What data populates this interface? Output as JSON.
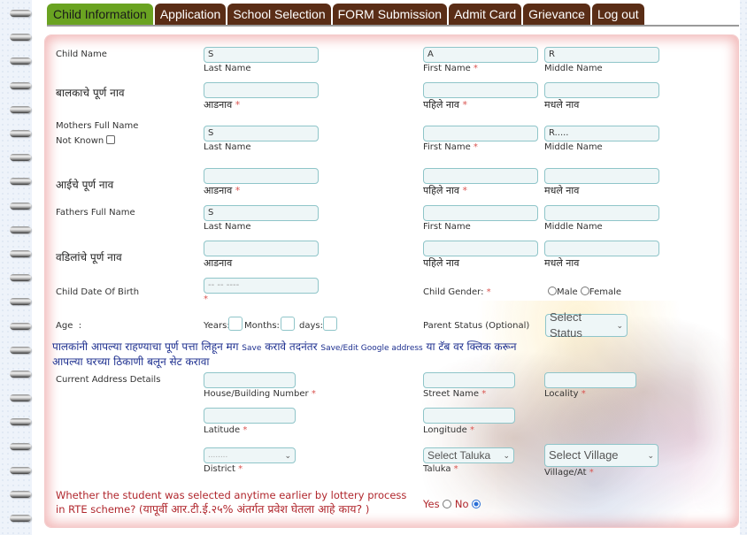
{
  "tabs": [
    {
      "label": "Child Information",
      "active": true
    },
    {
      "label": "Application",
      "active": false
    },
    {
      "label": "School Selection",
      "active": false
    },
    {
      "label": "FORM Submission",
      "active": false
    },
    {
      "label": "Admit Card",
      "active": false
    },
    {
      "label": "Grievance",
      "active": false
    },
    {
      "label": "Log out",
      "active": false
    }
  ],
  "form": {
    "child_name": {
      "label": "Child Name",
      "last_name_value": "S",
      "first_name_value": "A",
      "middle_name_value": "R",
      "last_name_label": "Last Name",
      "first_name_label": "First Name",
      "middle_name_label": "Middle Name"
    },
    "child_name_mr": {
      "label": "बालकाचे पूर्ण नाव",
      "last_name_label": "आडनाव",
      "first_name_label": "पहिले नाव",
      "middle_name_label": "मधले नाव"
    },
    "mother_name": {
      "label": "Mothers Full Name",
      "not_known_label": "Not Known",
      "last_name_value": "S",
      "first_name_value": "",
      "middle_name_value": "R.....",
      "last_name_label": "Last Name",
      "first_name_label": "First Name",
      "middle_name_label": "Middle Name"
    },
    "mother_name_mr": {
      "label": "आईचे पूर्ण नाव",
      "last_name_label": "आडनाव",
      "first_name_label": "पहिले नाव",
      "middle_name_label": "मधले नाव"
    },
    "father_name": {
      "label": "Fathers Full Name",
      "last_name_value": "S",
      "last_name_label": "Last Name",
      "first_name_label": "First Name",
      "middle_name_label": "Middle Name"
    },
    "father_name_mr": {
      "label": "वडिलांचे पूर्ण नाव",
      "last_name_label": "आडनाव",
      "first_name_label": "पहिले नाव",
      "middle_name_label": "मधले नाव"
    },
    "dob": {
      "label": "Child Date Of Birth",
      "value": "-- -- ----"
    },
    "gender": {
      "label": "Child Gender:",
      "options": [
        "Male",
        "Female"
      ],
      "selected": null
    },
    "age": {
      "label": "Age",
      "separator": ":",
      "years_label": "Years:",
      "months_label": "Months:",
      "days_label": "days:"
    },
    "parent_status": {
      "label": "Parent Status (Optional)",
      "selected": "Select Status"
    },
    "notice": {
      "part1": "पालकांनी आपल्या राहण्याचा पूर्ण पत्ता लिहून मग ",
      "save": "Save",
      "part2": " करावे तदनंतर ",
      "save_edit": "Save/Edit Google address",
      "part3": " या टॅब वर क्लिक करून आपल्या घरच्या ठिकाणी बलून सेट करावा"
    },
    "address": {
      "label": "Current Address Details",
      "house_label": "House/Building Number",
      "street_label": "Street Name",
      "locality_label": "Locality",
      "latitude_label": "Latitude",
      "longitude_label": "Longitude",
      "district_label": "District",
      "district_selected": "........",
      "taluka_label": "Taluka",
      "taluka_selected": "Select Taluka",
      "village_label": "Village/At",
      "village_selected": "Select Village"
    },
    "lottery_question": {
      "text_en": "Whether the student was selected anytime earlier by lottery process in RTE scheme? (",
      "text_mr": "यापूर्वी आर.टी.ई.२५% अंतर्गत प्रवेश घेतला आहे काय?",
      "text_end": " )",
      "yes_label": "Yes",
      "no_label": "No",
      "selected": "No"
    },
    "required_mark": "*"
  },
  "colors": {
    "active_tab": "#6aa321",
    "inactive_tab": "#5a2d16",
    "notice_text": "#1d2f8f",
    "question_text": "#b0262c",
    "required": "#d9534f"
  }
}
